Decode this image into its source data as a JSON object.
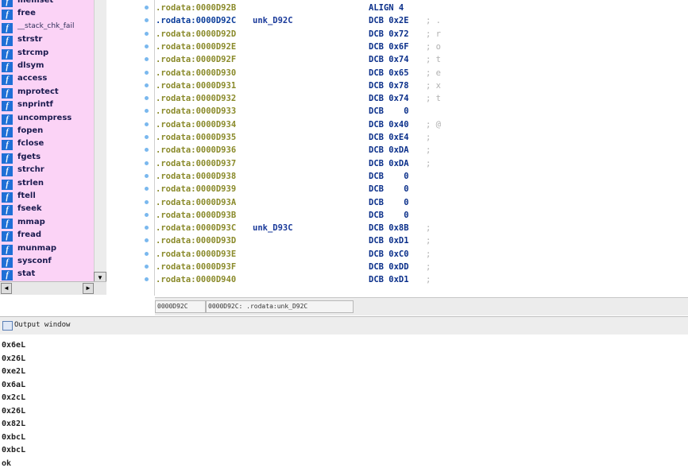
{
  "function_list": {
    "items": [
      {
        "name": "memset",
        "small": false
      },
      {
        "name": "free",
        "small": false
      },
      {
        "name": "__stack_chk_fail",
        "small": true
      },
      {
        "name": "strstr",
        "small": false
      },
      {
        "name": "strcmp",
        "small": false
      },
      {
        "name": "dlsym",
        "small": false
      },
      {
        "name": "access",
        "small": false
      },
      {
        "name": "mprotect",
        "small": false
      },
      {
        "name": "snprintf",
        "small": false
      },
      {
        "name": "uncompress",
        "small": false
      },
      {
        "name": "fopen",
        "small": false
      },
      {
        "name": "fclose",
        "small": false
      },
      {
        "name": "fgets",
        "small": false
      },
      {
        "name": "strchr",
        "small": false
      },
      {
        "name": "strlen",
        "small": false
      },
      {
        "name": "ftell",
        "small": false
      },
      {
        "name": "fseek",
        "small": false
      },
      {
        "name": "mmap",
        "small": false
      },
      {
        "name": "fread",
        "small": false
      },
      {
        "name": "munmap",
        "small": false
      },
      {
        "name": "sysconf",
        "small": false
      },
      {
        "name": "stat",
        "small": false
      }
    ],
    "icon_glyph": "f",
    "scroll_glyphs": {
      "down": "▼",
      "left": "◄",
      "right": "►"
    }
  },
  "disassembly": {
    "lines": [
      {
        "addr": ".rodata:0000D92B",
        "label": "",
        "instr": "ALIGN 4",
        "comment": "",
        "highlight": false
      },
      {
        "addr": ".rodata:0000D92C",
        "label": "unk_D92C",
        "instr": "DCB 0x2E",
        "comment": "; .",
        "highlight": true
      },
      {
        "addr": ".rodata:0000D92D",
        "label": "",
        "instr": "DCB 0x72",
        "comment": "; r",
        "highlight": false
      },
      {
        "addr": ".rodata:0000D92E",
        "label": "",
        "instr": "DCB 0x6F",
        "comment": "; o",
        "highlight": false
      },
      {
        "addr": ".rodata:0000D92F",
        "label": "",
        "instr": "DCB 0x74",
        "comment": "; t",
        "highlight": false
      },
      {
        "addr": ".rodata:0000D930",
        "label": "",
        "instr": "DCB 0x65",
        "comment": "; e",
        "highlight": false
      },
      {
        "addr": ".rodata:0000D931",
        "label": "",
        "instr": "DCB 0x78",
        "comment": "; x",
        "highlight": false
      },
      {
        "addr": ".rodata:0000D932",
        "label": "",
        "instr": "DCB 0x74",
        "comment": "; t",
        "highlight": false
      },
      {
        "addr": ".rodata:0000D933",
        "label": "",
        "instr": "DCB    0",
        "comment": "",
        "highlight": false
      },
      {
        "addr": ".rodata:0000D934",
        "label": "",
        "instr": "DCB 0x40",
        "comment": "; @",
        "highlight": false
      },
      {
        "addr": ".rodata:0000D935",
        "label": "",
        "instr": "DCB 0xE4",
        "comment": ";",
        "highlight": false
      },
      {
        "addr": ".rodata:0000D936",
        "label": "",
        "instr": "DCB 0xDA",
        "comment": ";",
        "highlight": false
      },
      {
        "addr": ".rodata:0000D937",
        "label": "",
        "instr": "DCB 0xDA",
        "comment": ";",
        "highlight": false
      },
      {
        "addr": ".rodata:0000D938",
        "label": "",
        "instr": "DCB    0",
        "comment": "",
        "highlight": false
      },
      {
        "addr": ".rodata:0000D939",
        "label": "",
        "instr": "DCB    0",
        "comment": "",
        "highlight": false
      },
      {
        "addr": ".rodata:0000D93A",
        "label": "",
        "instr": "DCB    0",
        "comment": "",
        "highlight": false
      },
      {
        "addr": ".rodata:0000D93B",
        "label": "",
        "instr": "DCB    0",
        "comment": "",
        "highlight": false
      },
      {
        "addr": ".rodata:0000D93C",
        "label": "unk_D93C",
        "instr": "DCB 0x8B",
        "comment": ";",
        "highlight": false
      },
      {
        "addr": ".rodata:0000D93D",
        "label": "",
        "instr": "DCB 0xD1",
        "comment": ";",
        "highlight": false
      },
      {
        "addr": ".rodata:0000D93E",
        "label": "",
        "instr": "DCB 0xC0",
        "comment": ";",
        "highlight": false
      },
      {
        "addr": ".rodata:0000D93F",
        "label": "",
        "instr": "DCB 0xDD",
        "comment": ";",
        "highlight": false
      },
      {
        "addr": ".rodata:0000D940",
        "label": "",
        "instr": "DCB 0xD1",
        "comment": ";",
        "highlight": false
      }
    ]
  },
  "status_bar": {
    "offset": "0000D92C",
    "location": "0000D92C: .rodata:unk_D92C"
  },
  "output_window": {
    "title": "Output window",
    "lines": [
      "0x6eL",
      "0x26L",
      "0xe2L",
      "0x6aL",
      "0x2cL",
      "0x26L",
      "0x82L",
      "0xbcL",
      "0xbcL",
      "ok"
    ]
  },
  "colors": {
    "function_panel_bg": "#fbd3f6",
    "function_icon": "#1f6fd6",
    "address": "#8a8a2a",
    "instruction": "#0a2f8a"
  }
}
